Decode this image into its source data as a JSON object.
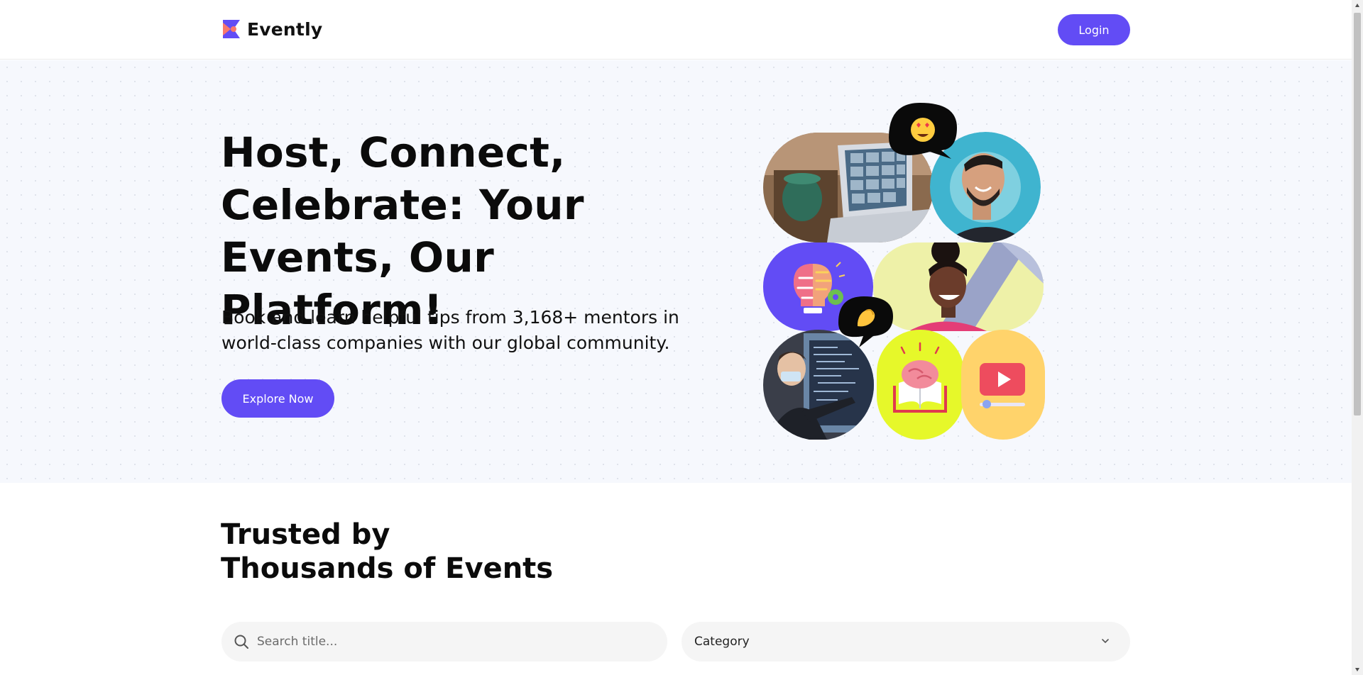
{
  "brand": {
    "name": "Evently",
    "accent": "#624cf5",
    "logo_colors": [
      "#624cf5",
      "#fa776c"
    ]
  },
  "header": {
    "login_label": "Login"
  },
  "hero": {
    "title": "Host, Connect, Celebrate: Your Events, Our Platform!",
    "subtitle": "Book and learn helpful tips from 3,168+ mentors in world-class companies with our global community.",
    "cta_label": "Explore Now",
    "collage": {
      "tiles": [
        "video-call-laptop-photo",
        "smiling-man-photo",
        "lightbulb-brain-icon",
        "laughing-woman-photo",
        "presenter-screen-photo",
        "brain-book-icon",
        "video-play-icon"
      ],
      "bubbles": [
        "heart-eyes-emoji",
        "pinching-hand-emoji"
      ],
      "colors": {
        "purple": "#624cf5",
        "lime": "#e6f82a",
        "yellow": "#ffd36b"
      }
    }
  },
  "trusted": {
    "line1": "Trusted by",
    "line2": "Thousands of Events"
  },
  "filters": {
    "search_placeholder": "Search title...",
    "category_label": "Category"
  }
}
